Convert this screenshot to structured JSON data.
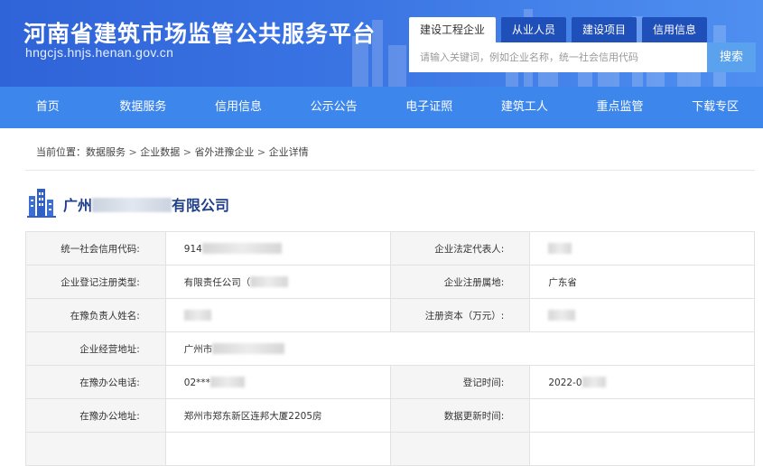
{
  "header": {
    "site_title": "河南省建筑市场监管公共服务平台",
    "site_url": "hngcjs.hnjs.henan.gov.cn",
    "search_tabs": [
      "建设工程企业",
      "从业人员",
      "建设项目",
      "信用信息"
    ],
    "active_search_tab": "建设工程企业",
    "search_placeholder": "请输入关键词，例如企业名称，统一社会信用代码",
    "search_button": "搜索"
  },
  "nav": {
    "items": [
      "首页",
      "数据服务",
      "信用信息",
      "公示公告",
      "电子证照",
      "建筑工人",
      "重点监管",
      "下载专区"
    ]
  },
  "breadcrumb": {
    "prefix": "当前位置：",
    "items": [
      "数据服务",
      "企业数据",
      "省外进豫企业",
      "企业详情"
    ],
    "separator": " > "
  },
  "company": {
    "name_prefix": "广州",
    "name_suffix": "有限公司"
  },
  "details": {
    "credit_code_label": "统一社会信用代码:",
    "credit_code_value": "914",
    "legal_rep_label": "企业法定代表人:",
    "legal_rep_value": "",
    "reg_type_label": "企业登记注册类型:",
    "reg_type_value": "有限责任公司（",
    "reg_place_label": "企业注册属地:",
    "reg_place_value": "广东省",
    "local_manager_label": "在豫负责人姓名:",
    "local_manager_value": "",
    "reg_capital_label": "注册资本（万元）:",
    "reg_capital_value": "",
    "address_label": "企业经营地址:",
    "address_value": "广州市",
    "office_phone_label": "在豫办公电话:",
    "office_phone_value": "02***",
    "reg_time_label": "登记时间:",
    "reg_time_value": "2022-0",
    "office_address_label": "在豫办公地址:",
    "office_address_value": "郑州市郑东新区连邦大厦2205房",
    "update_time_label": "数据更新时间:",
    "update_time_value": ""
  }
}
